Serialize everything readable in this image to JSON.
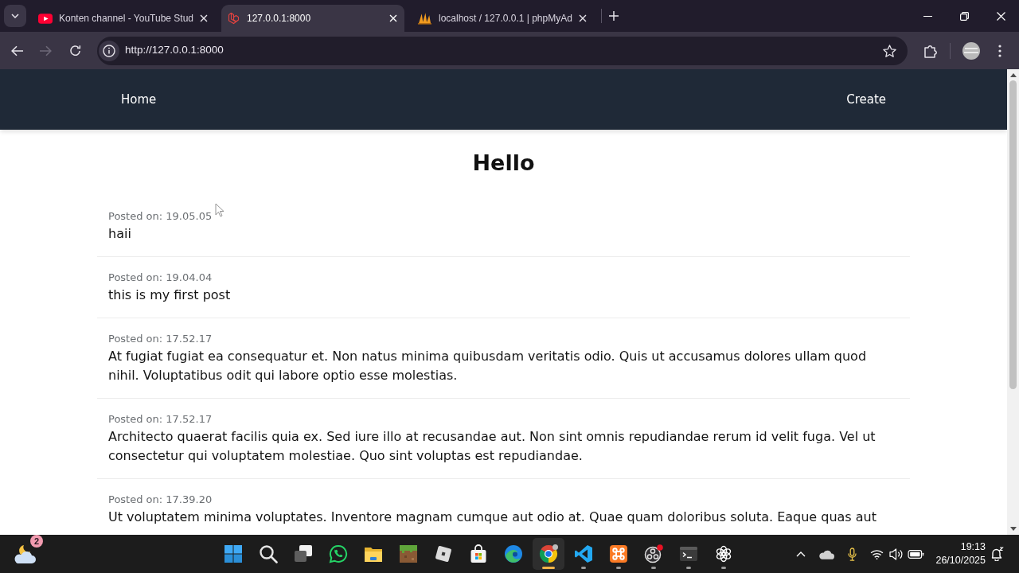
{
  "browser": {
    "tabs": [
      {
        "kind": "video",
        "title": "Konten channel - YouTube Stud",
        "selected": false
      },
      {
        "kind": "cube",
        "title": "127.0.0.1:8000",
        "selected": true
      },
      {
        "kind": "sails",
        "title": "localhost / 127.0.0.1 | phpMyAd",
        "selected": false
      }
    ],
    "nav_buttons": [
      {
        "kind": "back",
        "disabled": false
      },
      {
        "kind": "forward",
        "disabled": true
      },
      {
        "kind": "reload",
        "disabled": false
      }
    ],
    "address_bar": {
      "url": "http://127.0.0.1:8000"
    }
  },
  "page": {
    "navbar": {
      "links": [
        {
          "label": "Home"
        },
        {
          "label": "Create"
        }
      ]
    },
    "heading": "Hello",
    "posts": [
      {
        "posted_on": "Posted on: 19.05.05",
        "body": "haii"
      },
      {
        "posted_on": "Posted on: 19.04.04",
        "body": "this is my first post"
      },
      {
        "posted_on": "Posted on: 17.52.17",
        "body": "At fugiat fugiat ea consequatur et. Non natus minima quibusdam veritatis odio. Quis ut accusamus dolores ullam quod nihil. Voluptatibus odit qui labore optio esse molestias."
      },
      {
        "posted_on": "Posted on: 17.52.17",
        "body": "Architecto quaerat facilis quia ex. Sed iure illo at recusandae aut. Non sint omnis repudiandae rerum id velit fuga. Vel ut consectetur qui voluptatem molestiae. Quo sint voluptas est repudiandae."
      },
      {
        "posted_on": "Posted on: 17.39.20",
        "body": "Ut voluptatem minima voluptates. Inventore magnam cumque aut odio at. Quae quam doloribus soluta. Eaque quas aut"
      }
    ]
  },
  "taskbar": {
    "weather": {
      "badge": "2"
    },
    "apps": [
      {
        "kind": "grid",
        "running": false,
        "selected": false
      },
      {
        "kind": "search",
        "running": false,
        "selected": false
      },
      {
        "kind": "windows",
        "running": false,
        "selected": false
      },
      {
        "kind": "chat",
        "running": false,
        "selected": false
      },
      {
        "kind": "folder",
        "running": false,
        "selected": false
      },
      {
        "kind": "block",
        "running": false,
        "selected": false
      },
      {
        "kind": "tile",
        "running": false,
        "selected": false
      },
      {
        "kind": "bag",
        "running": false,
        "selected": false
      },
      {
        "kind": "wave",
        "running": false,
        "selected": false
      },
      {
        "kind": "ring",
        "running": true,
        "selected": true
      },
      {
        "kind": "code",
        "running": true,
        "selected": false
      },
      {
        "kind": "knot",
        "running": true,
        "selected": false
      },
      {
        "kind": "lens",
        "running": true,
        "selected": false
      },
      {
        "kind": "terminal",
        "running": true,
        "selected": false
      },
      {
        "kind": "flower",
        "running": true,
        "selected": false
      }
    ],
    "clock": {
      "time": "19:13",
      "date": "26/10/2025"
    }
  }
}
